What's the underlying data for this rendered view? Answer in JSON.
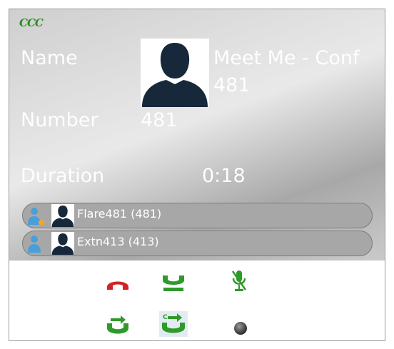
{
  "app": {
    "logo_text": "CCC"
  },
  "call": {
    "name_label": "Name",
    "name_value": "Meet Me - Conf",
    "name_sub": "481",
    "number_label": "Number",
    "number_value": "481",
    "duration_label": "Duration",
    "duration_value": "0:18"
  },
  "participants": [
    {
      "label": "Flare481 (481)",
      "icon": "user-speaking-icon"
    },
    {
      "label": "Extn413 (413)",
      "icon": "user-icon"
    }
  ],
  "actions": [
    {
      "name": "hangup-button",
      "icon": "hangup-icon"
    },
    {
      "name": "hold-button",
      "icon": "hold-icon"
    },
    {
      "name": "mute-button",
      "icon": "microphone-muted-icon"
    },
    {
      "name": "transfer-button",
      "icon": "transfer-icon"
    },
    {
      "name": "consult-transfer-button",
      "icon": "consult-transfer-icon"
    },
    {
      "name": "record-button",
      "icon": "record-icon"
    }
  ],
  "colors": {
    "accent": "#2e8b22",
    "hangup": "#d32222",
    "label": "#ffffff"
  }
}
